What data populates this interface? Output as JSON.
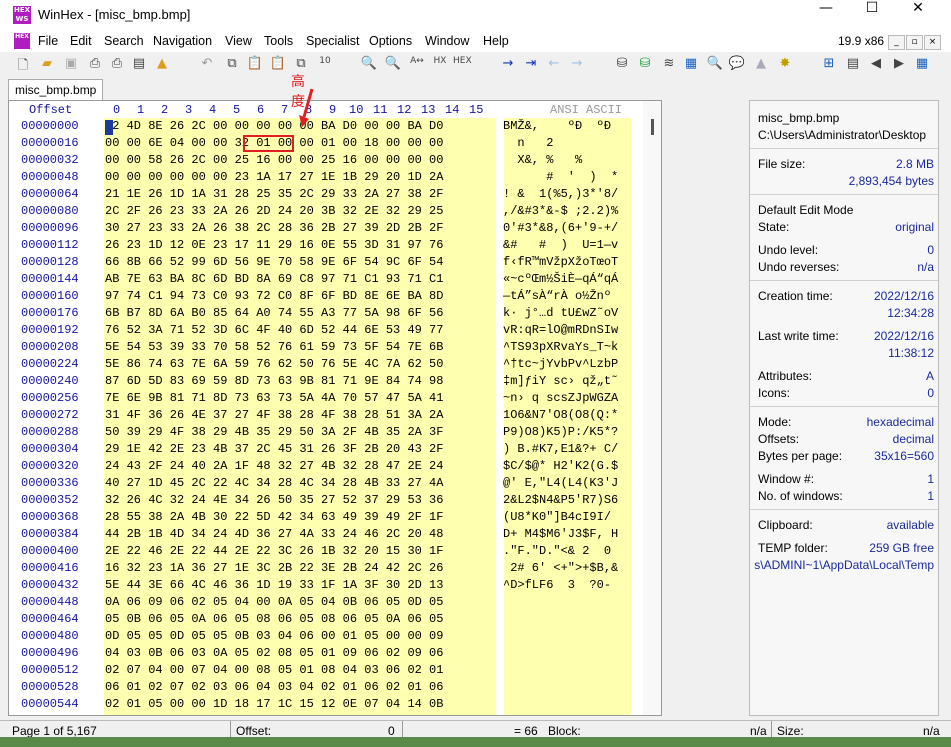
{
  "window": {
    "title": "WinHex - [misc_bmp.bmp]",
    "logo": "HEX\nworks"
  },
  "menu": [
    "File",
    "Edit",
    "Search",
    "Navigation",
    "View",
    "Tools",
    "Specialist",
    "Options",
    "Window",
    "Help"
  ],
  "menu_right": "19.9 x86",
  "tab": "misc_bmp.bmp",
  "annotation": "高度",
  "hex_header": {
    "offset": "Offset",
    "cols": [
      "0",
      "1",
      "2",
      "3",
      "4",
      "5",
      "6",
      "7",
      "8",
      "9",
      "10",
      "11",
      "12",
      "13",
      "14",
      "15"
    ],
    "ansi": "ANSI ASCII"
  },
  "rows": [
    {
      "offset": "00000000",
      "hex": "42 4D 8E 26 2C 00 00 00 00 00 BA D0 00 00 BA D0",
      "ascii": "BMŽ&,    ºÐ  ºÐ"
    },
    {
      "offset": "00000016",
      "hex": "00 00 6E 04 00 00 32 01 00 00 01 00 18 00 00 00",
      "ascii": "  n   2         "
    },
    {
      "offset": "00000032",
      "hex": "00 00 58 26 2C 00 25 16 00 00 25 16 00 00 00 00",
      "ascii": "  X&, %   %     "
    },
    {
      "offset": "00000048",
      "hex": "00 00 00 00 00 00 23 1A 17 27 1E 1B 29 20 1D 2A",
      "ascii": "      #  '  )  *"
    },
    {
      "offset": "00000064",
      "hex": "21 1E 26 1D 1A 31 28 25 35 2C 29 33 2A 27 38 2F",
      "ascii": "! &  1(%5,)3*'8/"
    },
    {
      "offset": "00000080",
      "hex": "2C 2F 26 23 33 2A 26 2D 24 20 3B 32 2E 32 29 25",
      "ascii": ",/&#3*&-$ ;2.2)%"
    },
    {
      "offset": "00000096",
      "hex": "30 27 23 33 2A 26 38 2C 28 36 2B 27 39 2D 2B 2F",
      "ascii": "0'#3*&8,(6+'9-+/"
    },
    {
      "offset": "00000112",
      "hex": "26 23 1D 12 0E 23 17 11 29 16 0E 55 3D 31 97 76",
      "ascii": "&#   #  )  U=1—v"
    },
    {
      "offset": "00000128",
      "hex": "66 8B 66 52 99 6D 56 9E 70 58 9E 6F 54 9C 6F 54",
      "ascii": "f‹fR™mVžpXžoTœoT"
    },
    {
      "offset": "00000144",
      "hex": "AB 7E 63 BA 8C 6D BD 8A 69 C8 97 71 C1 93 71 C1",
      "ascii": "«~cºŒm½ŠiÈ—qÁ“qÁ"
    },
    {
      "offset": "00000160",
      "hex": "97 74 C1 94 73 C0 93 72 C0 8F 6F BD 8E 6E BA 8D",
      "ascii": "—tÁ”sÀ“rÀ o½Žnº "
    },
    {
      "offset": "00000176",
      "hex": "6B B7 8D 6A B0 85 64 A0 74 55 A3 77 5A 98 6F 56",
      "ascii": "k· j°…d tU£wZ˜oV"
    },
    {
      "offset": "00000192",
      "hex": "76 52 3A 71 52 3D 6C 4F 40 6D 52 44 6E 53 49 77",
      "ascii": "vR:qR=lO@mRDnSIw"
    },
    {
      "offset": "00000208",
      "hex": "5E 54 53 39 33 70 58 52 76 61 59 73 5F 54 7E 6B",
      "ascii": "^TS93pXRvaYs_T~k"
    },
    {
      "offset": "00000224",
      "hex": "5E 86 74 63 7E 6A 59 76 62 50 76 5E 4C 7A 62 50",
      "ascii": "^†tc~jYvbPv^LzbP"
    },
    {
      "offset": "00000240",
      "hex": "87 6D 5D 83 69 59 8D 73 63 9B 81 71 9E 84 74 98",
      "ascii": "‡m]ƒiY sc› qž„t˜"
    },
    {
      "offset": "00000256",
      "hex": "7E 6E 9B 81 71 8D 73 63 73 5A 4A 70 57 47 5A 41",
      "ascii": "~n› q scsZJpWGZA"
    },
    {
      "offset": "00000272",
      "hex": "31 4F 36 26 4E 37 27 4F 38 28 4F 38 28 51 3A 2A",
      "ascii": "1O6&N7'O8(O8(Q:*"
    },
    {
      "offset": "00000288",
      "hex": "50 39 29 4F 38 29 4B 35 29 50 3A 2F 4B 35 2A 3F",
      "ascii": "P9)O8)K5)P:/K5*?"
    },
    {
      "offset": "00000304",
      "hex": "29 1E 42 2E 23 4B 37 2C 45 31 26 3F 2B 20 43 2F",
      "ascii": ") B.#K7,E1&?+ C/"
    },
    {
      "offset": "00000320",
      "hex": "24 43 2F 24 40 2A 1F 48 32 27 4B 32 28 47 2E 24",
      "ascii": "$C/$@* H2'K2(G.$"
    },
    {
      "offset": "00000336",
      "hex": "40 27 1D 45 2C 22 4C 34 28 4C 34 28 4B 33 27 4A",
      "ascii": "@' E,\"L4(L4(K3'J"
    },
    {
      "offset": "00000352",
      "hex": "32 26 4C 32 24 4E 34 26 50 35 27 52 37 29 53 36",
      "ascii": "2&L2$N4&P5'R7)S6"
    },
    {
      "offset": "00000368",
      "hex": "28 55 38 2A 4B 30 22 5D 42 34 63 49 39 49 2F 1F",
      "ascii": "(U8*K0\"]B4cI9I/ "
    },
    {
      "offset": "00000384",
      "hex": "44 2B 1B 4D 34 24 4D 36 27 4A 33 24 46 2C 20 48",
      "ascii": "D+ M4$M6'J3$F, H"
    },
    {
      "offset": "00000400",
      "hex": "2E 22 46 2E 22 44 2E 22 3C 26 1B 32 20 15 30 1F",
      "ascii": ".\"F.\"D.\"<& 2  0 "
    },
    {
      "offset": "00000416",
      "hex": "16 32 23 1A 36 27 1E 3C 2B 22 3E 2B 24 42 2C 26",
      "ascii": " 2# 6' <+\">+$B,&"
    },
    {
      "offset": "00000432",
      "hex": "5E 44 3E 66 4C 46 36 1D 19 33 1F 1A 3F 30 2D 13",
      "ascii": "^D>fLF6  3  ?0- "
    },
    {
      "offset": "00000448",
      "hex": "0A 06 09 06 02 05 04 00 0A 05 04 0B 06 05 0D 05",
      "ascii": ""
    },
    {
      "offset": "00000464",
      "hex": "05 0B 06 05 0A 06 05 08 06 05 08 06 05 0A 06 05",
      "ascii": ""
    },
    {
      "offset": "00000480",
      "hex": "0D 05 05 0D 05 05 0B 03 04 06 00 01 05 00 00 09",
      "ascii": ""
    },
    {
      "offset": "00000496",
      "hex": "04 03 0B 06 03 0A 05 02 08 05 01 09 06 02 09 06",
      "ascii": ""
    },
    {
      "offset": "00000512",
      "hex": "02 07 04 00 07 04 00 08 05 01 08 04 03 06 02 01",
      "ascii": ""
    },
    {
      "offset": "00000528",
      "hex": "06 01 02 07 02 03 06 04 03 04 02 01 06 02 01 06",
      "ascii": ""
    },
    {
      "offset": "00000544",
      "hex": "02 01 05 00 00 1D 18 17 1C 15 12 0E 07 04 14 0B",
      "ascii": ""
    }
  ],
  "info": {
    "filename": "misc_bmp.bmp",
    "path": "C:\\Users\\Administrator\\Desktop",
    "file_size_label": "File size:",
    "file_size_mb": "2.8 MB",
    "file_size_bytes": "2,893,454 bytes",
    "edit_mode_label": "Default Edit Mode",
    "state_label": "State:",
    "state_value": "original",
    "undo_level_label": "Undo level:",
    "undo_level_value": "0",
    "undo_rev_label": "Undo reverses:",
    "undo_rev_value": "n/a",
    "creation_label": "Creation time:",
    "creation_date": "2022/12/16",
    "creation_time": "12:34:28",
    "lastwrite_label": "Last write time:",
    "lastwrite_date": "2022/12/16",
    "lastwrite_time": "11:38:12",
    "attributes_label": "Attributes:",
    "attributes_value": "A",
    "icons_label": "Icons:",
    "icons_value": "0",
    "mode_label": "Mode:",
    "mode_value": "hexadecimal",
    "offsets_label": "Offsets:",
    "offsets_value": "decimal",
    "bpp_label": "Bytes per page:",
    "bpp_value": "35x16=560",
    "window_label": "Window #:",
    "window_value": "1",
    "nwin_label": "No. of windows:",
    "nwin_value": "1",
    "clipboard_label": "Clipboard:",
    "clipboard_value": "available",
    "temp_label": "TEMP folder:",
    "temp_value": "259 GB free",
    "temp_path": "s\\ADMINI~1\\AppData\\Local\\Temp"
  },
  "status": {
    "page": "Page 1 of 5,167",
    "offset_label": "Offset:",
    "offset_value": "0",
    "eq": "= 66",
    "block_label": "Block:",
    "block_value": "n/a",
    "size_label": "Size:",
    "size_value": "n/a"
  },
  "colors": {
    "hex_bg": "#ffffb0",
    "offset_blue": "#1515a0",
    "highlight": "#e02020"
  }
}
